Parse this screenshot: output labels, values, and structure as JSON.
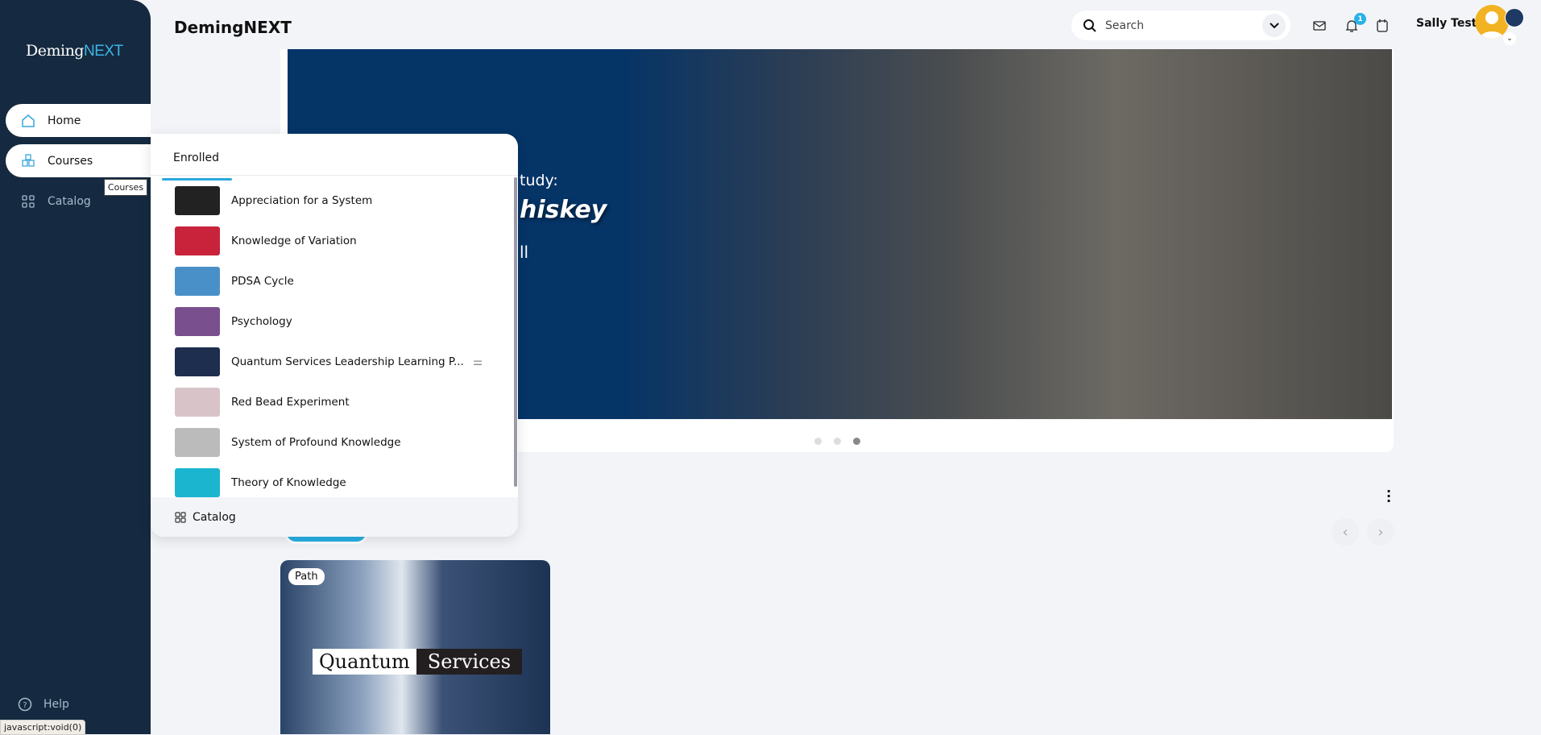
{
  "sidebar": {
    "logo": {
      "part1": "Deming",
      "part2": "NEXT"
    },
    "items": [
      {
        "label": "Home"
      },
      {
        "label": "Courses"
      },
      {
        "label": "Catalog"
      }
    ],
    "tooltip": "Courses",
    "help": "Help"
  },
  "status_bar": "javascript:void(0)",
  "header": {
    "title": "DemingNEXT",
    "search_placeholder": "Search",
    "notification_count": "1",
    "user_name": "Sally Test"
  },
  "hero": {
    "line1": "tudy:",
    "line2": "hiskey",
    "line3": "ll",
    "active_slide": 3,
    "slide_count": 3
  },
  "courses_popup": {
    "tab": "Enrolled",
    "items": [
      {
        "label": "Appreciation for a System",
        "color": "#222"
      },
      {
        "label": "Knowledge of Variation",
        "color": "#c8233b"
      },
      {
        "label": "PDSA Cycle",
        "color": "#4a90c8"
      },
      {
        "label": "Psychology",
        "color": "#7a4f8e"
      },
      {
        "label": "Quantum Services Leadership Learning P...",
        "color": "#1d2e4f"
      },
      {
        "label": "Red Bead Experiment",
        "color": "#d8c4c8"
      },
      {
        "label": "System of Profound Knowledge",
        "color": "#bbb"
      },
      {
        "label": "Theory of Knowledge",
        "color": "#1bb5cf"
      }
    ],
    "footer": "Catalog"
  },
  "card": {
    "badge": "Path",
    "title_part1": "Quantum",
    "title_part2": "Services"
  }
}
